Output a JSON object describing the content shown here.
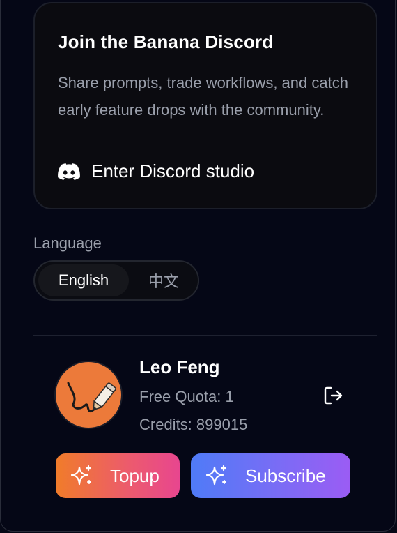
{
  "discord_card": {
    "title": "Join the Banana Discord",
    "description": "Share prompts, trade workflows, and catch early feature drops with the community.",
    "link_label": "Enter Discord studio",
    "icon": "discord-icon"
  },
  "language": {
    "label": "Language",
    "options": [
      "English",
      "中文"
    ],
    "selected": "English"
  },
  "user": {
    "name": "Leo Feng",
    "quota": "Free Quota: 1",
    "credits": "Credits: 899015",
    "avatar_color": "#ec7a3a",
    "logout_icon": "logout-icon"
  },
  "actions": {
    "topup_label": "Topup",
    "subscribe_label": "Subscribe",
    "icon": "sparkles-icon"
  },
  "colors": {
    "background": "#060816",
    "card": "#0b0b10",
    "muted_text": "#9a9fab",
    "topup_gradient": [
      "#f07c2a",
      "#e8468f"
    ],
    "subscribe_gradient": [
      "#4f7bf7",
      "#9b5cf4"
    ]
  }
}
